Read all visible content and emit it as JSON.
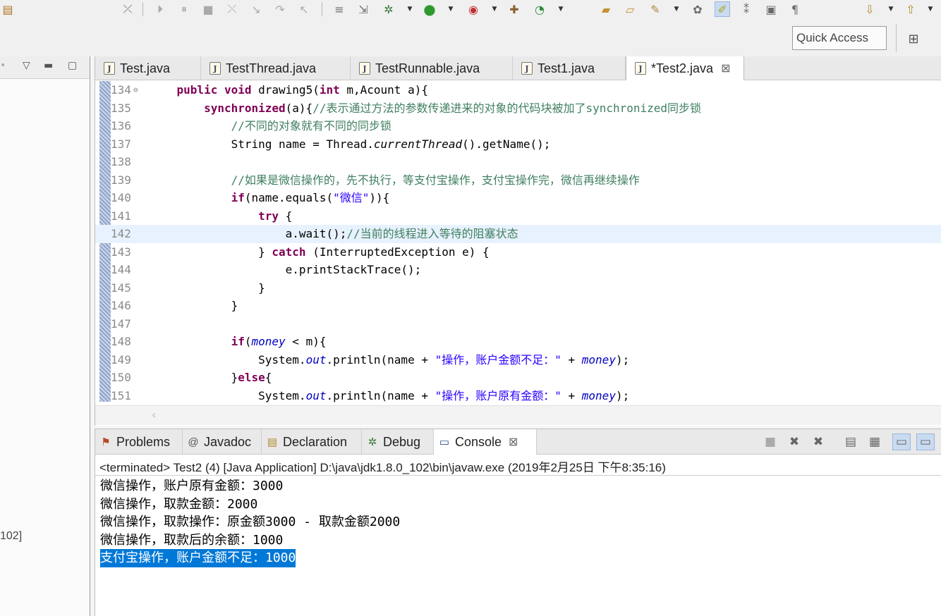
{
  "toolbar": {
    "quick_access_placeholder": "Quick Access",
    "icons": [
      "skip-breakpoints-icon",
      "resume-icon",
      "suspend-icon",
      "terminate-icon",
      "disconnect-icon",
      "step-into-icon",
      "step-over-icon",
      "step-return-icon",
      "drop-to-frame-icon",
      "use-step-filters-icon",
      "debug-icon",
      "run-icon",
      "coverage-icon",
      "external-tools-icon",
      "new-java-class-icon",
      "open-type-icon",
      "open-task-icon",
      "search-icon",
      "annotation-icon",
      "toggle-mark-occurrences-icon",
      "toggle-block-selection-icon",
      "show-whitespace-icon",
      "next-annotation-icon",
      "previous-annotation-icon",
      "open-perspective-icon"
    ]
  },
  "left_panel": {
    "clipped_text": "102]"
  },
  "editor": {
    "tabs": [
      {
        "label": "Test.java",
        "active": false
      },
      {
        "label": "TestThread.java",
        "active": false
      },
      {
        "label": "TestRunnable.java",
        "active": false
      },
      {
        "label": "Test1.java",
        "active": false
      },
      {
        "label": "*Test2.java",
        "active": true
      }
    ],
    "line_numbers": [
      "134",
      "135",
      "136",
      "137",
      "138",
      "139",
      "140",
      "141",
      "142",
      "143",
      "144",
      "145",
      "146",
      "147",
      "148",
      "149",
      "150",
      "151"
    ],
    "current_line": "142"
  },
  "views": {
    "tabs": [
      {
        "label": "Problems",
        "icon": "problems-icon"
      },
      {
        "label": "Javadoc",
        "icon": "javadoc-icon"
      },
      {
        "label": "Declaration",
        "icon": "declaration-icon"
      },
      {
        "label": "Debug",
        "icon": "debug-icon"
      },
      {
        "label": "Console",
        "icon": "console-icon",
        "active": true
      }
    ]
  },
  "console": {
    "status": "<terminated> Test2 (4) [Java Application] D:\\java\\jdk1.8.0_102\\bin\\javaw.exe (2019年2月25日 下午8:35:16)",
    "output": [
      "微信操作，账户原有金额：3000",
      "微信操作，取款金额：2000",
      "微信操作，取款操作：原金额3000 - 取款金额2000",
      "微信操作，取款后的余额：1000",
      "支付宝操作，账户金额不足：1000"
    ],
    "selected_line_index": 4
  }
}
